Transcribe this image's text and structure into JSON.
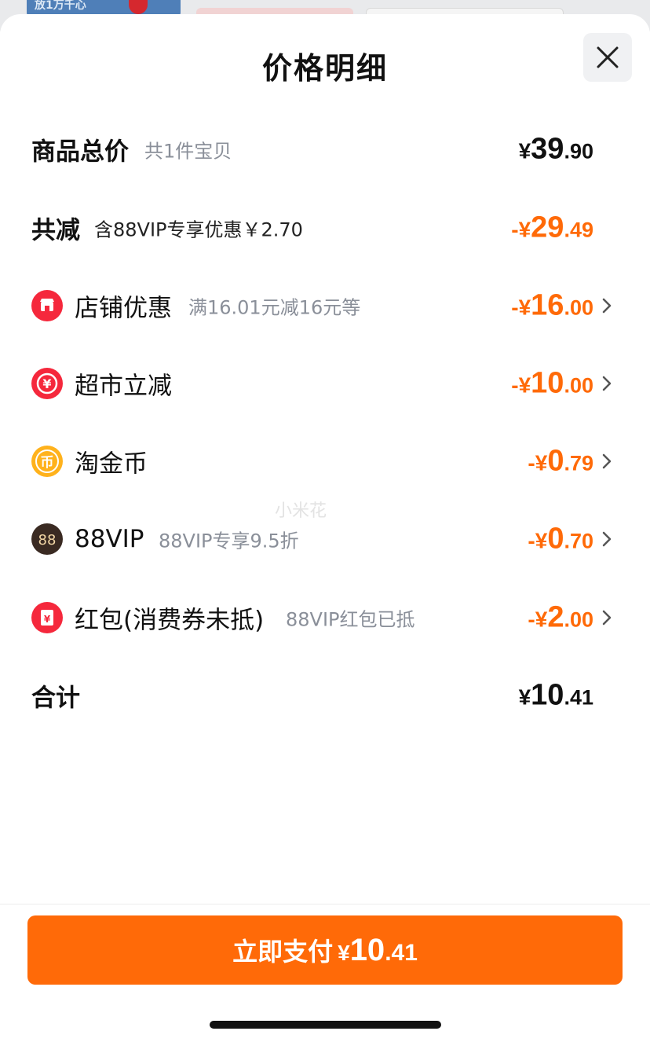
{
  "backdrop": {
    "banner_text": "放1万千心"
  },
  "sheet": {
    "title": "价格明细",
    "close_icon": "close-icon"
  },
  "rows": {
    "total": {
      "label": "商品总价",
      "sub": "共1件宝贝",
      "yen": "¥",
      "int": "39",
      "dec": ".90"
    },
    "discount": {
      "label": "共减",
      "sub": "含88VIP专享优惠￥2.70",
      "yen": "-¥",
      "int": "29",
      "dec": ".49"
    },
    "shop": {
      "icon": "shop-icon",
      "icon_color": "#f5283c",
      "label": "店铺优惠",
      "sub": "满16.01元减16元等",
      "yen": "-¥",
      "int": "16",
      "dec": ".00"
    },
    "market": {
      "icon": "yuan-coin-icon",
      "icon_color": "#f5283c",
      "label": "超市立减",
      "sub": "",
      "yen": "-¥",
      "int": "10",
      "dec": ".00"
    },
    "coin": {
      "icon": "gold-coin-icon",
      "icon_color": "#ffb21c",
      "icon_glyph": "币",
      "label": "淘金币",
      "sub": "",
      "yen": "-¥",
      "int": "0",
      "dec": ".79"
    },
    "vip": {
      "icon": "88vip-icon",
      "icon_color": "#3a2a22",
      "icon_glyph": "88",
      "label": "88VIP",
      "sub": "88VIP专享9.5折",
      "yen": "-¥",
      "int": "0",
      "dec": ".70"
    },
    "redpacket": {
      "icon": "red-packet-icon",
      "icon_color": "#f5283c",
      "icon_glyph": "¥",
      "label": "红包(消费券未抵)",
      "sub": "88VIP红包已抵",
      "yen": "-¥",
      "int": "2",
      "dec": ".00"
    },
    "sum": {
      "label": "合计",
      "yen": "¥",
      "int": "10",
      "dec": ".41"
    }
  },
  "watermark": "小米花",
  "pay_button": {
    "label": "立即支付",
    "yen": "¥",
    "int": "10",
    "dec": ".41"
  },
  "colors": {
    "accent": "#ff6a08",
    "text": "#111111",
    "muted": "#8a8f99"
  }
}
